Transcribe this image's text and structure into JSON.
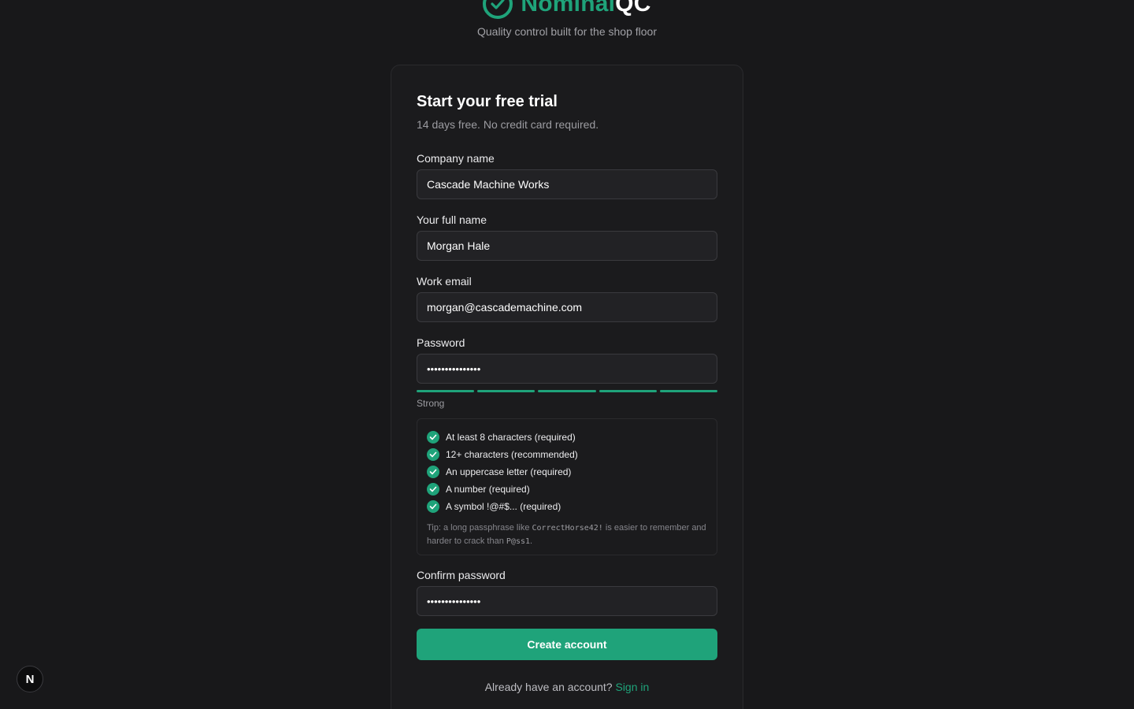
{
  "brand": {
    "name_accent": "Nominal",
    "name_rest": "QC",
    "tagline": "Quality control built for the shop floor",
    "logo_icon": "check-circle-icon",
    "accent_color": "#1fa37a"
  },
  "form": {
    "title": "Start your free trial",
    "subtitle": "14 days free. No credit card required.",
    "company": {
      "label": "Company name",
      "value": "Cascade Machine Works"
    },
    "fullname": {
      "label": "Your full name",
      "value": "Morgan Hale"
    },
    "email": {
      "label": "Work email",
      "value": "morgan@cascademachine.com"
    },
    "password": {
      "label": "Password",
      "value": "•••••••••••••••",
      "strength_label": "Strong",
      "strength_segments_filled": 5,
      "strength_segments_total": 5
    },
    "requirements": [
      {
        "text": "At least 8 characters (required)",
        "met": true
      },
      {
        "text": "12+ characters (recommended)",
        "met": true
      },
      {
        "text": "An uppercase letter (required)",
        "met": true
      },
      {
        "text": "A number (required)",
        "met": true
      },
      {
        "text": "A symbol !@#$... (required)",
        "met": true
      }
    ],
    "tip": {
      "prefix": "Tip: a long passphrase like",
      "example_good": "CorrectHorse42!",
      "middle": "is easier to remember and harder to crack than",
      "example_bad": "P@ss1",
      "suffix": "."
    },
    "confirm": {
      "label": "Confirm password",
      "value": "•••••••••••••••"
    },
    "submit_label": "Create account",
    "signin_prompt": "Already have an account?",
    "signin_link": "Sign in"
  },
  "badge": {
    "letter": "N"
  }
}
